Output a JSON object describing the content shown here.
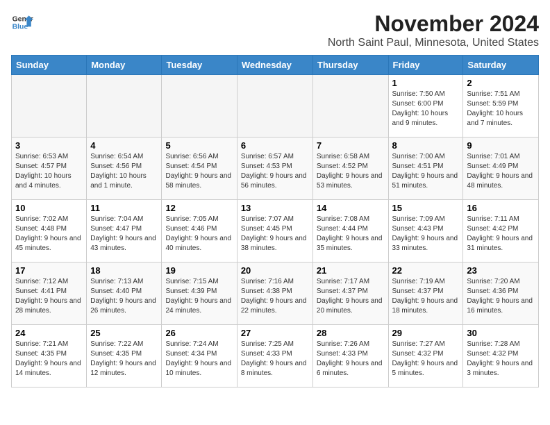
{
  "header": {
    "logo_line1": "General",
    "logo_line2": "Blue",
    "month": "November 2024",
    "location": "North Saint Paul, Minnesota, United States"
  },
  "weekdays": [
    "Sunday",
    "Monday",
    "Tuesday",
    "Wednesday",
    "Thursday",
    "Friday",
    "Saturday"
  ],
  "weeks": [
    [
      {
        "day": "",
        "info": ""
      },
      {
        "day": "",
        "info": ""
      },
      {
        "day": "",
        "info": ""
      },
      {
        "day": "",
        "info": ""
      },
      {
        "day": "",
        "info": ""
      },
      {
        "day": "1",
        "info": "Sunrise: 7:50 AM\nSunset: 6:00 PM\nDaylight: 10 hours and 9 minutes."
      },
      {
        "day": "2",
        "info": "Sunrise: 7:51 AM\nSunset: 5:59 PM\nDaylight: 10 hours and 7 minutes."
      }
    ],
    [
      {
        "day": "3",
        "info": "Sunrise: 6:53 AM\nSunset: 4:57 PM\nDaylight: 10 hours and 4 minutes."
      },
      {
        "day": "4",
        "info": "Sunrise: 6:54 AM\nSunset: 4:56 PM\nDaylight: 10 hours and 1 minute."
      },
      {
        "day": "5",
        "info": "Sunrise: 6:56 AM\nSunset: 4:54 PM\nDaylight: 9 hours and 58 minutes."
      },
      {
        "day": "6",
        "info": "Sunrise: 6:57 AM\nSunset: 4:53 PM\nDaylight: 9 hours and 56 minutes."
      },
      {
        "day": "7",
        "info": "Sunrise: 6:58 AM\nSunset: 4:52 PM\nDaylight: 9 hours and 53 minutes."
      },
      {
        "day": "8",
        "info": "Sunrise: 7:00 AM\nSunset: 4:51 PM\nDaylight: 9 hours and 51 minutes."
      },
      {
        "day": "9",
        "info": "Sunrise: 7:01 AM\nSunset: 4:49 PM\nDaylight: 9 hours and 48 minutes."
      }
    ],
    [
      {
        "day": "10",
        "info": "Sunrise: 7:02 AM\nSunset: 4:48 PM\nDaylight: 9 hours and 45 minutes."
      },
      {
        "day": "11",
        "info": "Sunrise: 7:04 AM\nSunset: 4:47 PM\nDaylight: 9 hours and 43 minutes."
      },
      {
        "day": "12",
        "info": "Sunrise: 7:05 AM\nSunset: 4:46 PM\nDaylight: 9 hours and 40 minutes."
      },
      {
        "day": "13",
        "info": "Sunrise: 7:07 AM\nSunset: 4:45 PM\nDaylight: 9 hours and 38 minutes."
      },
      {
        "day": "14",
        "info": "Sunrise: 7:08 AM\nSunset: 4:44 PM\nDaylight: 9 hours and 35 minutes."
      },
      {
        "day": "15",
        "info": "Sunrise: 7:09 AM\nSunset: 4:43 PM\nDaylight: 9 hours and 33 minutes."
      },
      {
        "day": "16",
        "info": "Sunrise: 7:11 AM\nSunset: 4:42 PM\nDaylight: 9 hours and 31 minutes."
      }
    ],
    [
      {
        "day": "17",
        "info": "Sunrise: 7:12 AM\nSunset: 4:41 PM\nDaylight: 9 hours and 28 minutes."
      },
      {
        "day": "18",
        "info": "Sunrise: 7:13 AM\nSunset: 4:40 PM\nDaylight: 9 hours and 26 minutes."
      },
      {
        "day": "19",
        "info": "Sunrise: 7:15 AM\nSunset: 4:39 PM\nDaylight: 9 hours and 24 minutes."
      },
      {
        "day": "20",
        "info": "Sunrise: 7:16 AM\nSunset: 4:38 PM\nDaylight: 9 hours and 22 minutes."
      },
      {
        "day": "21",
        "info": "Sunrise: 7:17 AM\nSunset: 4:37 PM\nDaylight: 9 hours and 20 minutes."
      },
      {
        "day": "22",
        "info": "Sunrise: 7:19 AM\nSunset: 4:37 PM\nDaylight: 9 hours and 18 minutes."
      },
      {
        "day": "23",
        "info": "Sunrise: 7:20 AM\nSunset: 4:36 PM\nDaylight: 9 hours and 16 minutes."
      }
    ],
    [
      {
        "day": "24",
        "info": "Sunrise: 7:21 AM\nSunset: 4:35 PM\nDaylight: 9 hours and 14 minutes."
      },
      {
        "day": "25",
        "info": "Sunrise: 7:22 AM\nSunset: 4:35 PM\nDaylight: 9 hours and 12 minutes."
      },
      {
        "day": "26",
        "info": "Sunrise: 7:24 AM\nSunset: 4:34 PM\nDaylight: 9 hours and 10 minutes."
      },
      {
        "day": "27",
        "info": "Sunrise: 7:25 AM\nSunset: 4:33 PM\nDaylight: 9 hours and 8 minutes."
      },
      {
        "day": "28",
        "info": "Sunrise: 7:26 AM\nSunset: 4:33 PM\nDaylight: 9 hours and 6 minutes."
      },
      {
        "day": "29",
        "info": "Sunrise: 7:27 AM\nSunset: 4:32 PM\nDaylight: 9 hours and 5 minutes."
      },
      {
        "day": "30",
        "info": "Sunrise: 7:28 AM\nSunset: 4:32 PM\nDaylight: 9 hours and 3 minutes."
      }
    ]
  ]
}
